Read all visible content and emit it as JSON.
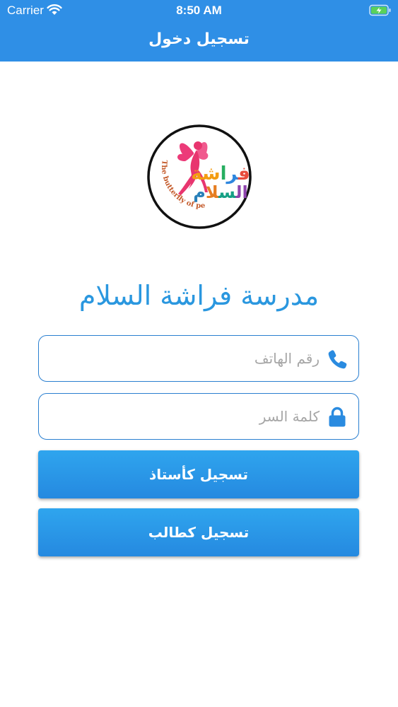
{
  "status_bar": {
    "carrier": "Carrier",
    "time": "8:50 AM",
    "wifi_icon": "wifi-icon",
    "battery_icon": "battery-charging-icon"
  },
  "nav": {
    "title": "تسجيل دخول"
  },
  "logo": {
    "arabic_text": "فراشة السلام",
    "english_text": "The butterfly of peace",
    "icon": "butterfly-fairy-icon"
  },
  "school_name": "مدرسة فراشة السلام",
  "form": {
    "phone_placeholder": "رقم الهاتف",
    "phone_value": "",
    "phone_icon": "phone-icon",
    "password_placeholder": "كلمة السر",
    "password_value": "",
    "password_icon": "lock-icon"
  },
  "buttons": {
    "teacher_login": "تسجيل كأستاذ",
    "student_login": "تسجيل كطالب"
  },
  "colors": {
    "primary": "#2f8fe6",
    "title_text": "#2a97df",
    "field_border": "#2a7fd0",
    "logo_figure": "#e8356f"
  }
}
